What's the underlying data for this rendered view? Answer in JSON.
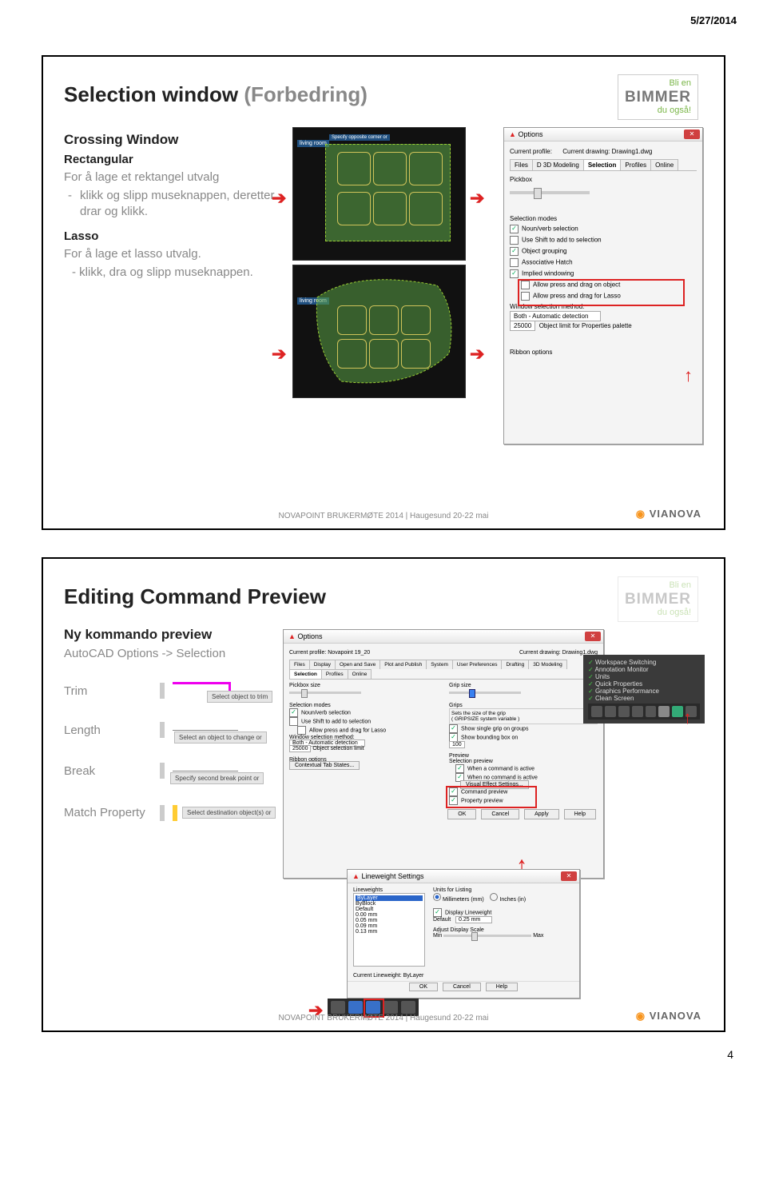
{
  "header_date": "5/27/2014",
  "page_number": "4",
  "logo": {
    "top": "Bli en",
    "main": "BIMMER",
    "bottom": "du også!"
  },
  "footer": "NOVAPOINT BRUKERMØTE 2014 | Haugesund 20-22 mai",
  "vianova": "VIANOVA",
  "slide1": {
    "title_main": "Selection window",
    "title_sub": "(Forbedring)",
    "h_crossing": "Crossing Window",
    "h_rect": "Rectangular",
    "rect_intro": "For å lage et rektangel utvalg",
    "rect_item": "klikk og slipp museknappen, deretter drar og klikk.",
    "h_lasso": "Lasso",
    "lasso_intro": "For å lage et lasso utvalg.",
    "lasso_item": "- klikk, dra og slipp museknappen.",
    "options_title": "Options",
    "current_prof": "Current profile:",
    "current_draw": "Current drawing:",
    "draw_val": "Drawing1.dwg",
    "tab_files": "Files",
    "tab_3d": "D 3D Modeling",
    "tab_sel": "Selection",
    "tab_prof": "Profiles",
    "tab_online": "Online",
    "pickbox": "Pickbox",
    "sel_modes": "Selection modes",
    "cb1": "Noun/verb selection",
    "cb2": "Use Shift to add to selection",
    "cb3": "Object grouping",
    "cb4": "Associative Hatch",
    "cb5": "Implied windowing",
    "cb6": "Allow press and drag on object",
    "cb7": "Allow press and drag for Lasso",
    "win_method": "Window selection method:",
    "method_val": "Both - Automatic detection",
    "limit": "25000",
    "limit_label": "Object limit for Properties palette",
    "ribbon": "Ribbon options",
    "living": "living room"
  },
  "slide2": {
    "title": "Editing Command Preview",
    "h_ny": "Ny kommando preview",
    "sub": "AutoCAD Options -> Selection",
    "trim": "Trim",
    "length": "Length",
    "break": "Break",
    "match": "Match Property",
    "trim_hint": "Select object to trim",
    "length_hint": "Select an object to change or",
    "break_hint": "Specify second break point or",
    "match_hint": "Select destination object(s) or",
    "opt_title": "Options",
    "cur_prof": "Current profile:",
    "prof_val": "Novapoint 19_20",
    "cur_draw": "Current drawing:",
    "draw_val": "Drawing1.dwg",
    "t_display": "Display",
    "t_open": "Open and Save",
    "t_plot": "Plot and Publish",
    "t_system": "System",
    "t_user": "User Preferences",
    "t_draft": "Drafting",
    "t_3d": "3D Modeling",
    "t_sel": "Selection",
    "t_prof": "Profiles",
    "t_online": "Online",
    "pickbox": "Pickbox size",
    "grip": "Grip size",
    "sel_modes": "Selection modes",
    "cb1": "Noun/verb selection",
    "cb2": "Use Shift to add to selection",
    "cb3": "Allow press and drag for Lasso",
    "win_method": "Window selection method:",
    "method": "Both - Automatic detection",
    "limit": "25000",
    "limit_lbl": "Object selection limit",
    "ribbon": "Ribbon options",
    "ctx": "Contextual Tab States...",
    "grips_h": "Grips",
    "grip_hint": "Sets the size of the grip",
    "grip_sys": "GRIPSIZE system variable",
    "show_grip": "Show single grip on groups",
    "show_bound": "Show bounding box on",
    "grip_limit": "100",
    "preview_h": "Preview",
    "sel_preview": "Selection preview",
    "when_cmd": "When a command is active",
    "when_no": "When no command is active",
    "vis_eff": "Visual Effect Settings...",
    "cmd_prev": "Command preview",
    "prop_prev": "Property preview",
    "ok": "OK",
    "cancel": "Cancel",
    "apply": "Apply",
    "help": "Help",
    "lw_title": "Lineweight Settings",
    "lw_list": "Lineweights",
    "bylayer": "ByLayer",
    "byblock": "ByBlock",
    "default": "Default",
    "lw1": "0.00 mm",
    "lw2": "0.05 mm",
    "lw3": "0.09 mm",
    "lw4": "0.13 mm",
    "units": "Units for Listing",
    "mm": "Millimeters (mm)",
    "in": "Inches (in)",
    "disp_lw": "Display Lineweight",
    "def_lbl": "Default",
    "def_val": "0.25 mm",
    "scale": "Adjust Display Scale",
    "min": "Min",
    "max": "Max",
    "cur_lw": "Current Lineweight:",
    "cur_lw_val": "ByLayer",
    "tray1": "Workspace Switching",
    "tray2": "Annotation Monitor",
    "tray3": "Units",
    "tray4": "Quick Properties",
    "tray5": "Graphics Performance",
    "tray6": "Clean Screen"
  }
}
